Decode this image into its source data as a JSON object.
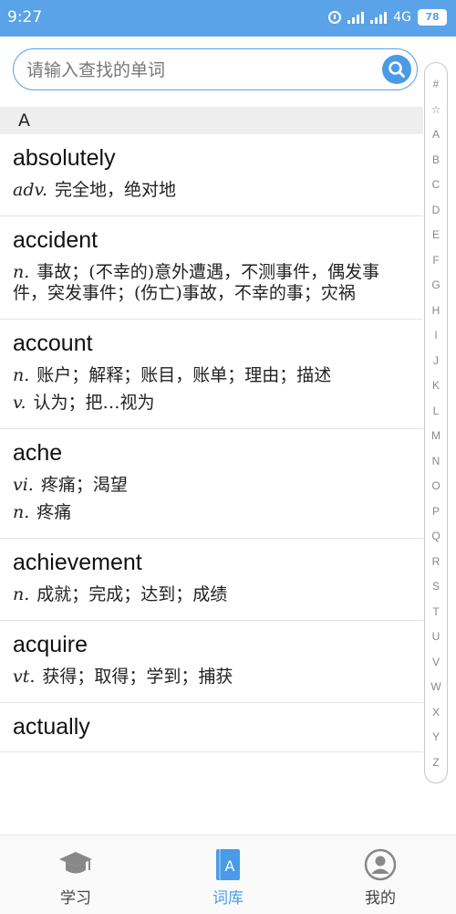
{
  "status_bar": {
    "time": "9:27",
    "network": "4G",
    "battery": "78"
  },
  "search": {
    "placeholder": "请输入查找的单词"
  },
  "section_header": "A",
  "entries": [
    {
      "word": "absolutely",
      "defs": [
        {
          "pos": "adv.",
          "text": "完全地，绝对地"
        }
      ]
    },
    {
      "word": "accident",
      "defs": [
        {
          "pos": "n.",
          "text": "事故；(不幸的)意外遭遇，不测事件，偶发事件，突发事件；(伤亡)事故，不幸的事；灾祸"
        }
      ]
    },
    {
      "word": "account",
      "defs": [
        {
          "pos": "n.",
          "text": "账户；解释；账目，账单；理由；描述"
        },
        {
          "pos": "v.",
          "text": "认为；把…视为"
        }
      ]
    },
    {
      "word": "ache",
      "defs": [
        {
          "pos": "vi.",
          "text": "疼痛；渴望"
        },
        {
          "pos": "n.",
          "text": "疼痛"
        }
      ]
    },
    {
      "word": "achievement",
      "defs": [
        {
          "pos": "n.",
          "text": "成就；完成；达到；成绩"
        }
      ]
    },
    {
      "word": "acquire",
      "defs": [
        {
          "pos": "vt.",
          "text": "获得；取得；学到；捕获"
        }
      ]
    },
    {
      "word": "actually",
      "defs": []
    }
  ],
  "alphabet_index": [
    "#",
    "☆",
    "A",
    "B",
    "C",
    "D",
    "E",
    "F",
    "G",
    "H",
    "I",
    "J",
    "K",
    "L",
    "M",
    "N",
    "O",
    "P",
    "Q",
    "R",
    "S",
    "T",
    "U",
    "V",
    "W",
    "X",
    "Y",
    "Z"
  ],
  "bottom_nav": [
    {
      "label": "学习",
      "icon": "graduation-cap-icon",
      "active": false
    },
    {
      "label": "词库",
      "icon": "book-a-icon",
      "active": true
    },
    {
      "label": "我的",
      "icon": "user-avatar-icon",
      "active": false
    }
  ],
  "colors": {
    "accent": "#4a9be6",
    "status_bar": "#5aa3e8"
  }
}
